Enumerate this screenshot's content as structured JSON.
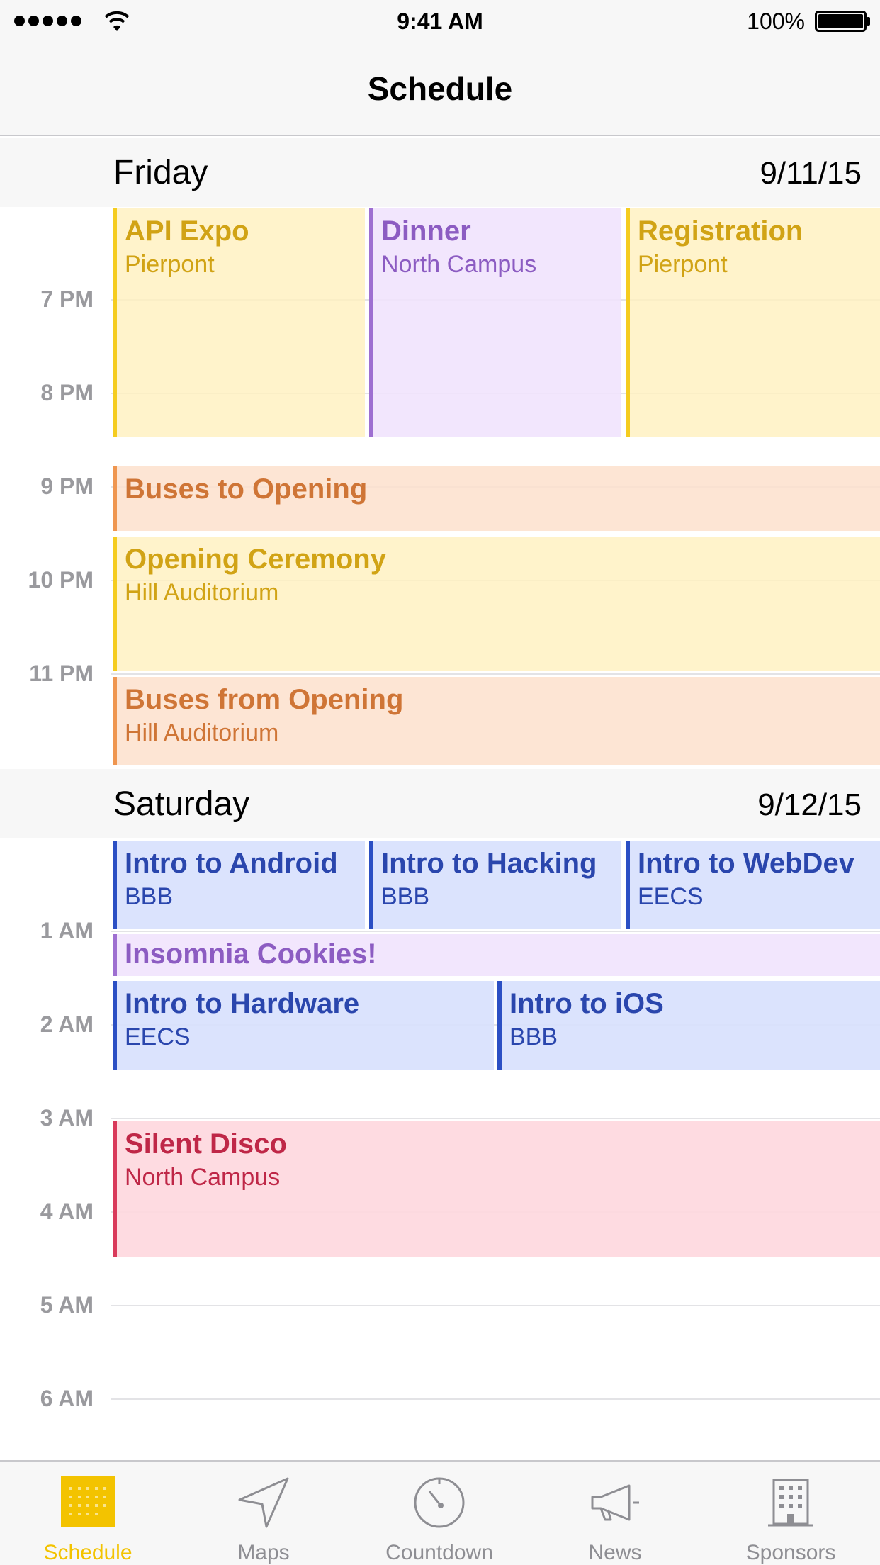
{
  "status_bar": {
    "time": "9:41 AM",
    "battery": "100%"
  },
  "nav": {
    "title": "Schedule"
  },
  "days": [
    {
      "name": "Friday",
      "date": "9/11/15",
      "hours": [
        "7 PM",
        "8 PM",
        "9 PM",
        "10 PM",
        "11 PM"
      ],
      "events": [
        {
          "title": "API Expo",
          "location": "Pierpont",
          "color": "yellow"
        },
        {
          "title": "Dinner",
          "location": "North Campus",
          "color": "purple"
        },
        {
          "title": "Registration",
          "location": "Pierpont",
          "color": "yellow"
        },
        {
          "title": "Buses to Opening",
          "location": "",
          "color": "orange"
        },
        {
          "title": "Opening Ceremony",
          "location": "Hill Auditorium",
          "color": "yellow"
        },
        {
          "title": "Buses from Opening",
          "location": "Hill Auditorium",
          "color": "orange"
        }
      ]
    },
    {
      "name": "Saturday",
      "date": "9/12/15",
      "hours": [
        "1 AM",
        "2 AM",
        "3 AM",
        "4 AM",
        "5 AM",
        "6 AM"
      ],
      "events": [
        {
          "title": "Intro to Android",
          "location": "BBB",
          "color": "blue"
        },
        {
          "title": "Intro to Hacking",
          "location": "BBB",
          "color": "blue"
        },
        {
          "title": "Intro to WebDev",
          "location": "EECS",
          "color": "blue"
        },
        {
          "title": "Insomnia Cookies!",
          "location": "",
          "color": "purple"
        },
        {
          "title": "Intro to Hardware",
          "location": "EECS",
          "color": "blue"
        },
        {
          "title": "Intro to iOS",
          "location": "BBB",
          "color": "blue"
        },
        {
          "title": "Silent Disco",
          "location": "North Campus",
          "color": "pink"
        }
      ]
    }
  ],
  "tabs": [
    {
      "label": "Schedule",
      "icon": "calendar-grid-icon",
      "active": true
    },
    {
      "label": "Maps",
      "icon": "location-arrow-icon",
      "active": false
    },
    {
      "label": "Countdown",
      "icon": "stopwatch-icon",
      "active": false
    },
    {
      "label": "News",
      "icon": "megaphone-icon",
      "active": false
    },
    {
      "label": "Sponsors",
      "icon": "building-icon",
      "active": false
    }
  ],
  "colors": {
    "accent": "#f3c300",
    "yellow": "#d1a315",
    "purple": "#8c5cc2",
    "orange": "#cf7536",
    "blue": "#2a46ad",
    "pink": "#bf2747",
    "inactive_tab": "#8e8e93"
  }
}
